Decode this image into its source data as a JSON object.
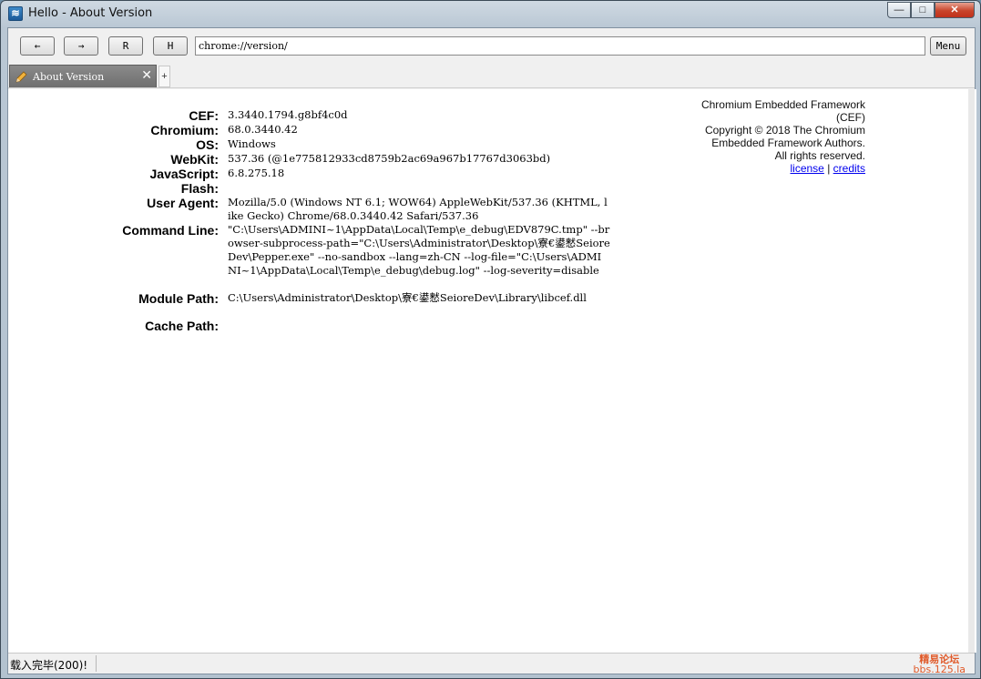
{
  "window": {
    "title": "Hello - About Version",
    "caption": {
      "minimize": "—",
      "maximize": "□",
      "close": "✕"
    }
  },
  "toolbar": {
    "back_label": "←",
    "forward_label": "→",
    "reload_label": "R",
    "home_label": "H",
    "url": "chrome://version/",
    "menu_label": "Menu"
  },
  "tabs": {
    "active_label": "About Version",
    "close_glyph": "✕",
    "add_glyph": "+"
  },
  "version_info": [
    {
      "key": "CEF:",
      "value": "3.3440.1794.g8bf4c0d"
    },
    {
      "key": "Chromium:",
      "value": "68.0.3440.42"
    },
    {
      "key": "OS:",
      "value": "Windows"
    },
    {
      "key": "WebKit:",
      "value": "537.36 (@1e775812933cd8759b2ac69a967b17767d3063bd)"
    },
    {
      "key": "JavaScript:",
      "value": "6.8.275.18"
    },
    {
      "key": "Flash:",
      "value": ""
    },
    {
      "key": "User Agent:",
      "value": "Mozilla/5.0 (Windows NT 6.1; WOW64) AppleWebKit/537.36 (KHTML, like Gecko) Chrome/68.0.3440.42 Safari/537.36"
    },
    {
      "key": "Command Line:",
      "value": "\"C:\\Users\\ADMINI~1\\AppData\\Local\\Temp\\e_debug\\EDV879C.tmp\" --browser-subprocess-path=\"C:\\Users\\Administrator\\Desktop\\寮€鍙慭SeioreDev\\Pepper.exe\" --no-sandbox --lang=zh-CN --log-file=\"C:\\Users\\ADMINI~1\\AppData\\Local\\Temp\\e_debug\\debug.log\" --log-severity=disable"
    },
    {
      "key": "Module Path:",
      "value": "C:\\Users\\Administrator\\Desktop\\寮€鍙慭SeioreDev\\Library\\libcef.dll"
    },
    {
      "key": "Cache Path:",
      "value": ""
    }
  ],
  "credits": {
    "line1": "Chromium Embedded Framework",
    "line2": "(CEF)",
    "line3": "Copyright © 2018 The Chromium",
    "line4": "Embedded Framework Authors.",
    "line5": "All rights reserved.",
    "license_link": "license",
    "separator": " | ",
    "credits_link": "credits"
  },
  "status": {
    "text": "载入完毕(200)!",
    "watermark_line1": "精易论坛",
    "watermark_line2": "bbs.125.la"
  },
  "colors": {
    "link": "#0000ee",
    "watermark": "#e05a2a",
    "close_button": "#c8442a"
  }
}
